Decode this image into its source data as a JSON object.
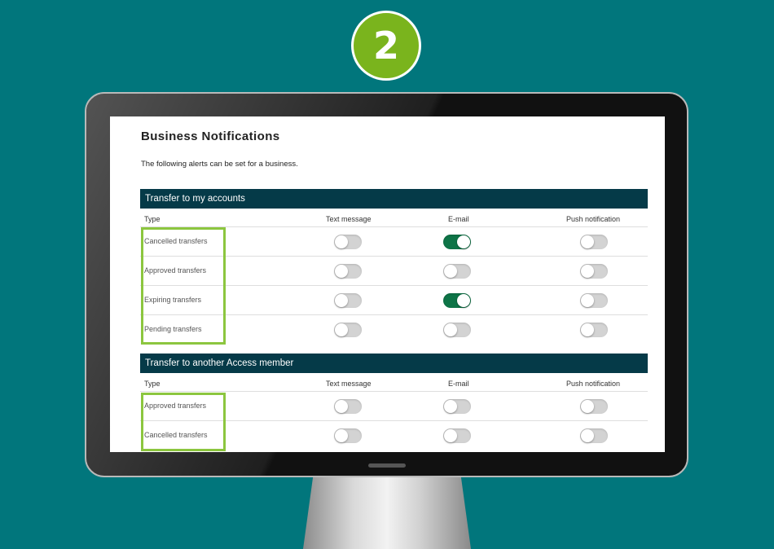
{
  "step_number": "2",
  "page": {
    "title": "Business Notifications",
    "description": "The following alerts can be set for a business."
  },
  "columns": {
    "type": "Type",
    "text": "Text message",
    "email": "E-mail",
    "push": "Push notification"
  },
  "sections": [
    {
      "title": "Transfer to my accounts",
      "rows": [
        {
          "label": "Cancelled transfers",
          "text": false,
          "email": true,
          "push": false
        },
        {
          "label": "Approved transfers",
          "text": false,
          "email": false,
          "push": false
        },
        {
          "label": "Expiring transfers",
          "text": false,
          "email": true,
          "push": false
        },
        {
          "label": "Pending transfers",
          "text": false,
          "email": false,
          "push": false
        }
      ]
    },
    {
      "title": "Transfer to another Access member",
      "rows": [
        {
          "label": "Approved transfers",
          "text": false,
          "email": false,
          "push": false
        },
        {
          "label": "Cancelled transfers",
          "text": false,
          "email": false,
          "push": false
        }
      ]
    }
  ],
  "colors": {
    "background": "#01767c",
    "header": "#053a48",
    "toggle_on": "#0e7447",
    "toggle_off": "#d3d3d3",
    "highlight": "#8cc63f",
    "badge": "#7ab41d"
  }
}
